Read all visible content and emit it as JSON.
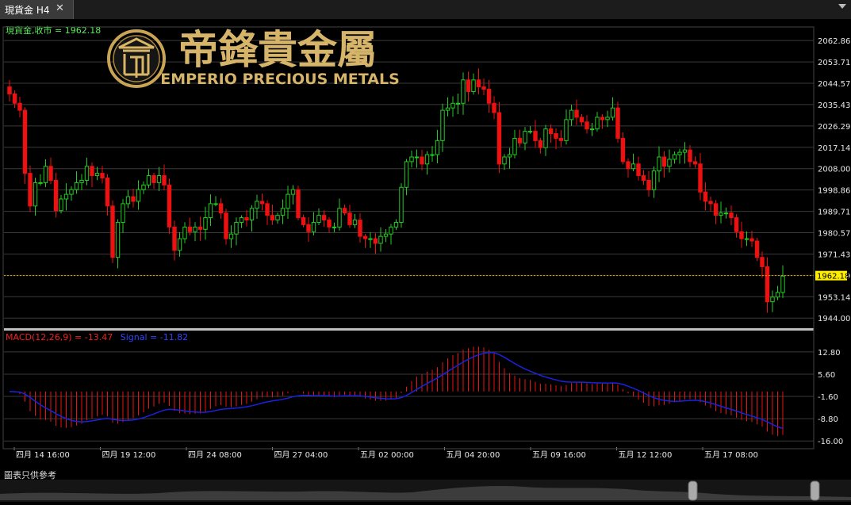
{
  "window": {
    "tab_title": "現貨金 H4",
    "close_glyph": "✕"
  },
  "logo": {
    "chinese_name": "帝鋒貴金屬",
    "english_name": "EMPERIO PRECIOUS METALS"
  },
  "footer": {
    "note": "圖表只供參考"
  },
  "colors": {
    "bull": "#22cc22",
    "bear": "#ee1111",
    "signal": "#1a22dd",
    "grid": "#3a3a3a",
    "current_price": "#ffee00",
    "label_instrument": "#55ee55",
    "label_macd": "#ee2222"
  },
  "chart_data": [
    {
      "type": "candlestick",
      "title": "現貨金,收市 = 1962.18",
      "instrument_label": "現貨金,收市 = 1962.18",
      "timeframe": "H4",
      "current_price": 1962.18,
      "current_price_label": "1962.18",
      "ylim": [
        1940.0,
        2068.0
      ],
      "y_ticks": [
        2062.86,
        2053.71,
        2044.57,
        2035.43,
        2026.29,
        2017.14,
        2008.0,
        1998.86,
        1989.71,
        1980.57,
        1971.43,
        1962.29,
        1953.14,
        1944.0
      ],
      "y_tick_labels": [
        "2062.86",
        "2053.71",
        "2044.57",
        "2035.43",
        "2026.29",
        "2017.14",
        "2008.00",
        "1998.86",
        "1989.71",
        "1980.57",
        "1971.43",
        "1962.29",
        "1953.14",
        "1944.00"
      ],
      "x_tick_labels": [
        "四月 14 16:00",
        "四月 19 12:00",
        "四月 24 08:00",
        "四月 27 04:00",
        "五月 02 00:00",
        "五月 04 20:00",
        "五月 09 16:00",
        "五月 12 12:00",
        "五月 17 08:00"
      ],
      "grid": true,
      "closes": [
        2040,
        2036,
        2033,
        2006,
        1992,
        2002,
        2002,
        2009,
        2003,
        1990,
        1995,
        1997,
        1999,
        2002,
        2003,
        2009,
        2005,
        2006,
        2004,
        1992,
        1970,
        1985,
        1993,
        1996,
        1994,
        1999,
        2001,
        2005,
        2002,
        2005,
        2001,
        1983,
        1973,
        1978,
        1983,
        1981,
        1983,
        1982,
        1987,
        1993,
        1993,
        1989,
        1978,
        1980,
        1985,
        1987,
        1986,
        1991,
        1994,
        1993,
        1988,
        1986,
        1988,
        1991,
        1997,
        1999,
        1987,
        1984,
        1981,
        1985,
        1988,
        1986,
        1983,
        1983,
        1991,
        1989,
        1984,
        1986,
        1979,
        1978,
        1978,
        1976,
        1979,
        1980,
        1983,
        1985,
        2000,
        2011,
        2013,
        2013,
        2010,
        2014,
        2014,
        2020,
        2033,
        2034,
        2036,
        2036,
        2046,
        2041,
        2046,
        2043,
        2042,
        2036,
        2032,
        2010,
        2013,
        2014,
        2021,
        2019,
        2024,
        2024,
        2020,
        2017,
        2025,
        2023,
        2021,
        2020,
        2029,
        2033,
        2030,
        2028,
        2025,
        2025,
        2030,
        2029,
        2030,
        2034,
        2021,
        2011,
        2008,
        2010,
        2005,
        2003,
        1999,
        2007,
        2013,
        2009,
        2012,
        2014,
        2015,
        2016,
        2011,
        2010,
        1998,
        1994,
        1993,
        1988,
        1989,
        1989,
        1987,
        1981,
        1978,
        1978,
        1977,
        1970,
        1966,
        1951,
        1953,
        1955,
        1962
      ]
    },
    {
      "type": "macd",
      "title": "MACD(12,26,9) = -13.47",
      "macd_label": "MACD(12,26,9) = -13.47",
      "signal_label": "Signal = -11.82",
      "series": [
        {
          "name": "MACD(12,26,9)",
          "last_value": -13.47
        },
        {
          "name": "Signal",
          "last_value": -11.82
        }
      ],
      "ylim": [
        -18.0,
        15.6
      ],
      "y_ticks": [
        12.8,
        5.6,
        -1.6,
        -8.8,
        -16.0
      ],
      "y_tick_labels": [
        "12.80",
        "5.60",
        "-1.60",
        "-8.80",
        "-16.00"
      ],
      "grid": true
    }
  ]
}
